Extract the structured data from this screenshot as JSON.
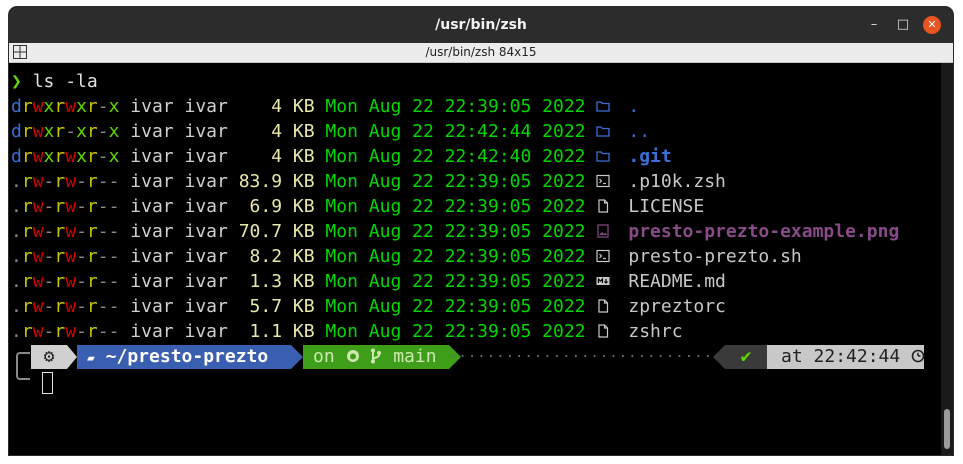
{
  "window": {
    "title": "/usr/bin/zsh",
    "subtitle": "/usr/bin/zsh 84x15",
    "controls": {
      "minimize": "–",
      "maximize": "□",
      "close": "✕"
    }
  },
  "terminal": {
    "prompt_symbol": "❯",
    "command": "ls -la",
    "rows": [
      {
        "perms": [
          "d",
          "r",
          "w",
          "x",
          "r",
          "w",
          "x",
          "r",
          "-",
          "x"
        ],
        "user": "ivar",
        "group": "ivar",
        "size": "  4",
        "unit": "KB",
        "date": "Mon Aug 22 22:39:05 2022",
        "icon": "folder-icon",
        "name": ".",
        "kind": "dir"
      },
      {
        "perms": [
          "d",
          "r",
          "w",
          "x",
          "r",
          "-",
          "x",
          "r",
          "-",
          "x"
        ],
        "user": "ivar",
        "group": "ivar",
        "size": "  4",
        "unit": "KB",
        "date": "Mon Aug 22 22:42:44 2022",
        "icon": "folder-icon",
        "name": "..",
        "kind": "dir"
      },
      {
        "perms": [
          "d",
          "r",
          "w",
          "x",
          "r",
          "w",
          "x",
          "r",
          "-",
          "x"
        ],
        "user": "ivar",
        "group": "ivar",
        "size": "  4",
        "unit": "KB",
        "date": "Mon Aug 22 22:42:40 2022",
        "icon": "folder-icon",
        "name": ".git",
        "kind": "dir"
      },
      {
        "perms": [
          ".",
          "r",
          "w",
          "-",
          "r",
          "w",
          "-",
          "r",
          "-",
          "-"
        ],
        "user": "ivar",
        "group": "ivar",
        "size": "83.9",
        "unit": "KB",
        "date": "Mon Aug 22 22:39:05 2022",
        "icon": "terminal-file-icon",
        "name": ".p10k.zsh",
        "kind": "file"
      },
      {
        "perms": [
          ".",
          "r",
          "w",
          "-",
          "r",
          "w",
          "-",
          "r",
          "-",
          "-"
        ],
        "user": "ivar",
        "group": "ivar",
        "size": " 6.9",
        "unit": "KB",
        "date": "Mon Aug 22 22:39:05 2022",
        "icon": "document-icon",
        "name": "LICENSE",
        "kind": "file"
      },
      {
        "perms": [
          ".",
          "r",
          "w",
          "-",
          "r",
          "w",
          "-",
          "r",
          "-",
          "-"
        ],
        "user": "ivar",
        "group": "ivar",
        "size": "70.7",
        "unit": "KB",
        "date": "Mon Aug 22 22:39:05 2022",
        "icon": "image-file-icon",
        "name": "presto-prezto-example.png",
        "kind": "image"
      },
      {
        "perms": [
          ".",
          "r",
          "w",
          "-",
          "r",
          "w",
          "-",
          "r",
          "-",
          "-"
        ],
        "user": "ivar",
        "group": "ivar",
        "size": " 8.2",
        "unit": "KB",
        "date": "Mon Aug 22 22:39:05 2022",
        "icon": "terminal-file-icon",
        "name": "presto-prezto.sh",
        "kind": "file"
      },
      {
        "perms": [
          ".",
          "r",
          "w",
          "-",
          "r",
          "w",
          "-",
          "r",
          "-",
          "-"
        ],
        "user": "ivar",
        "group": "ivar",
        "size": " 1.3",
        "unit": "KB",
        "date": "Mon Aug 22 22:39:05 2022",
        "icon": "markdown-icon",
        "name": "README.md",
        "kind": "file"
      },
      {
        "perms": [
          ".",
          "r",
          "w",
          "-",
          "r",
          "w",
          "-",
          "r",
          "-",
          "-"
        ],
        "user": "ivar",
        "group": "ivar",
        "size": " 5.7",
        "unit": "KB",
        "date": "Mon Aug 22 22:39:05 2022",
        "icon": "document-icon",
        "name": "zpreztorc",
        "kind": "file"
      },
      {
        "perms": [
          ".",
          "r",
          "w",
          "-",
          "r",
          "w",
          "-",
          "r",
          "-",
          "-"
        ],
        "user": "ivar",
        "group": "ivar",
        "size": " 1.1",
        "unit": "KB",
        "date": "Mon Aug 22 22:39:05 2022",
        "icon": "document-icon",
        "name": "zshrc",
        "kind": "file"
      }
    ]
  },
  "powerline": {
    "os_icon": "⚙",
    "dir_icon": "▰",
    "dir": "~/presto-prezto",
    "git_prefix": "on",
    "git_icon": "github-icon",
    "branch_icon": "branch-icon",
    "branch": "main",
    "status_ok": "✔",
    "time_prefix": "at",
    "time": "22:42:44",
    "clock_icon": "clock-icon"
  },
  "colors": {
    "dir_blue": "#3a6fd8",
    "date_green": "#00d700",
    "read_yellow": "#c5c500",
    "write_red": "#d70000",
    "exec_green": "#5fd700",
    "image_purple": "#8a4a8a",
    "close_orange": "#e95420"
  }
}
